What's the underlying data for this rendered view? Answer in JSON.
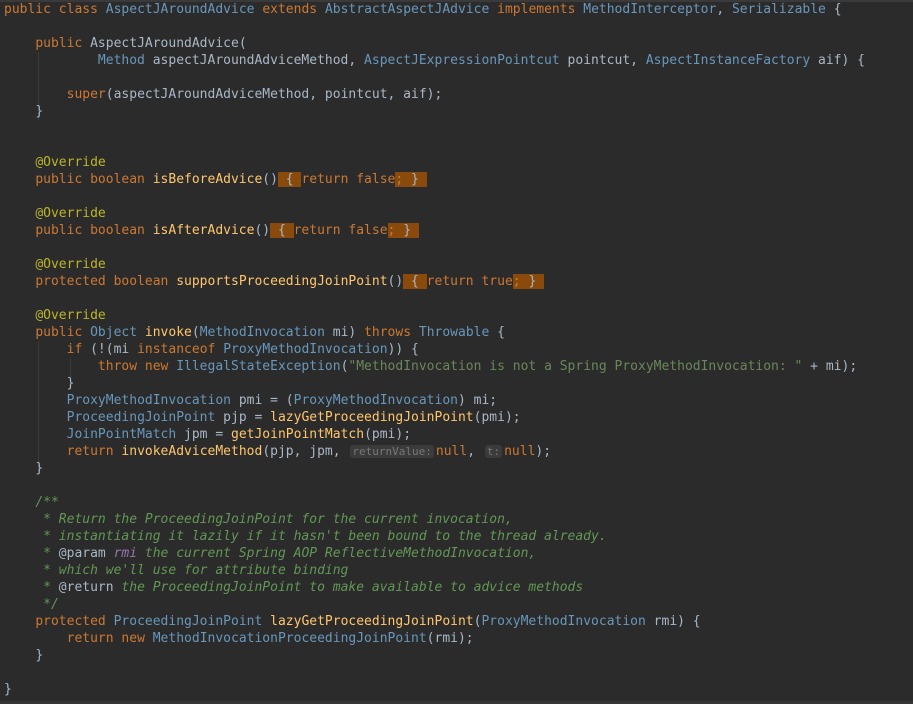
{
  "code": {
    "l1": {
      "public": "public",
      "class": "class",
      "name": "AspectJAroundAdvice",
      "extends": "extends",
      "base": "AbstractAspectJAdvice",
      "implements": "implements",
      "iface1": "MethodInterceptor",
      "comma": ",",
      "iface2": "Serializable",
      "brace": "{"
    },
    "ctor": {
      "public": "public",
      "name": "AspectJAroundAdvice",
      "open": "("
    },
    "ctor_params": {
      "t1": "Method",
      "p1": "aspectJAroundAdviceMethod",
      "t2": "AspectJExpressionPointcut",
      "p2": "pointcut",
      "t3": "AspectInstanceFactory",
      "p3": "aif",
      "close": ") {"
    },
    "ctor_super": {
      "kw": "super",
      "args": "(aspectJAroundAdviceMethod, pointcut, aif);"
    },
    "close1": "}",
    "override1": "@Override",
    "m1": {
      "mod": "public boolean",
      "name": "isBeforeAdvice",
      "parens": "()",
      "ob": "{",
      "ret": "return",
      "val": "false",
      "semi": ";",
      "cb": "}"
    },
    "override2": "@Override",
    "m2": {
      "mod": "public boolean",
      "name": "isAfterAdvice",
      "parens": "()",
      "ob": "{",
      "ret": "return",
      "val": "false",
      "semi": ";",
      "cb": "}"
    },
    "override3": "@Override",
    "m3": {
      "mod": "protected boolean",
      "name": "supportsProceedingJoinPoint",
      "parens": "()",
      "ob": "{",
      "ret": "return",
      "val": "true",
      "semi": ";",
      "cb": "}"
    },
    "override4": "@Override",
    "invoke": {
      "public": "public",
      "rtype": "Object",
      "name": "invoke",
      "open": "(",
      "ptype": "MethodInvocation",
      "pname": "mi",
      "close": ")",
      "throws": "throws",
      "ex": "Throwable",
      "brace": "{"
    },
    "if": {
      "kw": "if",
      "p1": "(!(mi",
      "inst": "instanceof",
      "type": "ProxyMethodInvocation",
      "p2": ")) {"
    },
    "throw": {
      "kw": "throw new",
      "type": "IllegalStateException",
      "open": "(",
      "msg": "\"MethodInvocation is not a Spring ProxyMethodInvocation: \"",
      "rest": " + mi);"
    },
    "close_if": "}",
    "pmi": {
      "type": "ProxyMethodInvocation",
      "rest1": " pmi = (",
      "cast": "ProxyMethodInvocation",
      "rest2": ") mi;"
    },
    "pjp": {
      "type": "ProceedingJoinPoint",
      "rest1": " pjp = ",
      "call": "lazyGetProceedingJoinPoint",
      "rest2": "(pmi);"
    },
    "jpm": {
      "type": "JoinPointMatch",
      "rest1": " jpm = ",
      "call": "getJoinPointMatch",
      "rest2": "(pmi);"
    },
    "ret": {
      "kw": "return",
      "call": "invokeAdviceMethod",
      "args": "(pjp, jpm, ",
      "hint1": "returnValue:",
      "v1": "null",
      "comma": ", ",
      "hint2": "t:",
      "v2": "null",
      "end": ");"
    },
    "close_invoke": "}",
    "doc": {
      "open": "/**",
      "l1": " * Return the ProceedingJoinPoint for the current invocation,",
      "l2": " * instantiating it lazily if it hasn't been bound to the thread already.",
      "l3_star": " * ",
      "l3_tag": "@param",
      "l3_name": " rmi",
      "l3_text": " the current Spring AOP ReflectiveMethodInvocation,",
      "l4": " * which we'll use for attribute binding",
      "l5_star": " * ",
      "l5_tag": "@return",
      "l5_text": " the ProceedingJoinPoint to make available to advice methods",
      "close": " */"
    },
    "lazy": {
      "mod": "protected",
      "rtype": "ProceedingJoinPoint",
      "name": "lazyGetProceedingJoinPoint",
      "open": "(",
      "ptype": "ProxyMethodInvocation",
      "pname": "rmi",
      "close": ") {"
    },
    "lazy_ret": {
      "kw": "return new",
      "type": "MethodInvocationProceedingJoinPoint",
      "args": "(rmi);"
    },
    "close_lazy": "}",
    "close_class": "}"
  }
}
